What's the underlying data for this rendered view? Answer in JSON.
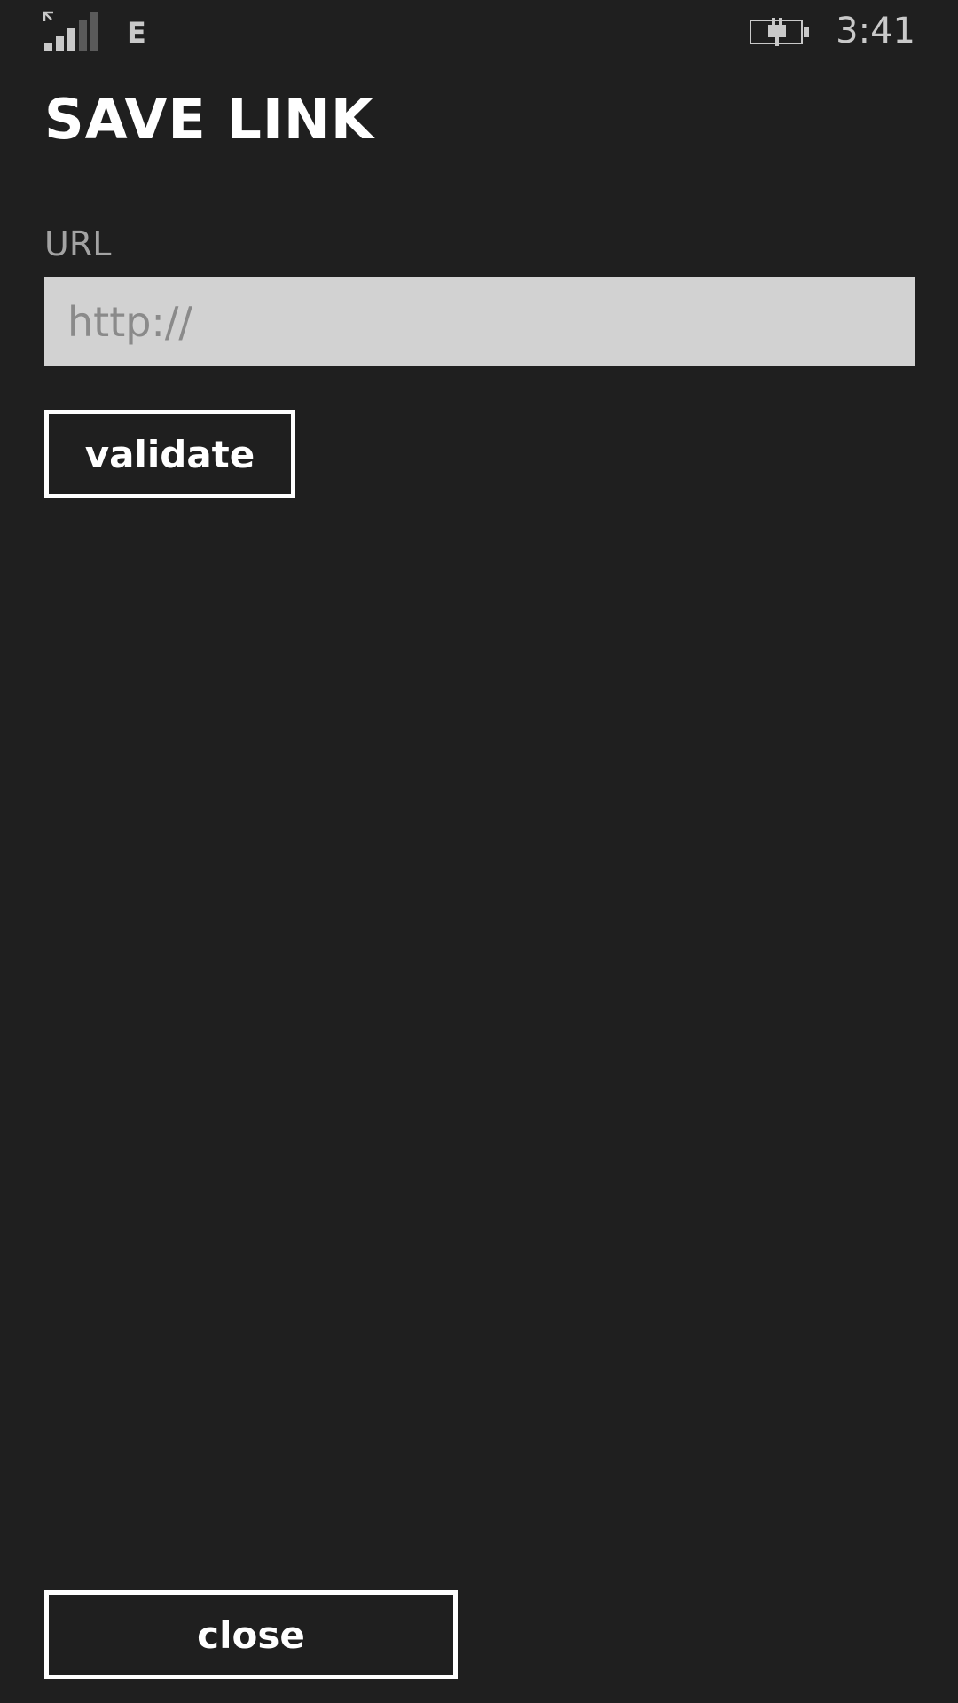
{
  "status_bar": {
    "network_type": "E",
    "time": "3:41",
    "icons": [
      "signal-strength-icon",
      "battery-charging-icon"
    ]
  },
  "page": {
    "title": "SAVE LINK"
  },
  "form": {
    "url_label": "URL",
    "url_placeholder": "http://",
    "url_value": "",
    "validate_label": "validate"
  },
  "footer": {
    "close_label": "close"
  },
  "colors": {
    "background": "#1f1f1f",
    "input_background": "#d2d2d2",
    "label": "#a3a3a3",
    "button_border": "#ffffff"
  }
}
